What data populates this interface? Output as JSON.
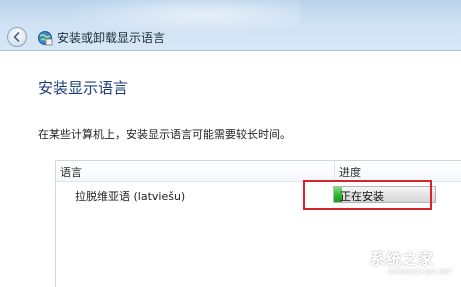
{
  "window": {
    "title": "安装或卸载显示语言"
  },
  "icons": {
    "back": "back-arrow-icon",
    "window": "globe-language-icon"
  },
  "dialog": {
    "heading": "安装显示语言",
    "info": "在某些计算机上，安装显示语言可能需要较长时间。"
  },
  "list": {
    "columns": {
      "language": "语言",
      "progress": "进度"
    },
    "rows": [
      {
        "language": "拉脱维亚语 (latviešu)",
        "status": "正在安装",
        "progress_fraction": 0.08
      }
    ]
  },
  "watermark": {
    "text": "系统之家",
    "url": "XITONGZHIJIA.NET"
  },
  "colors": {
    "heading": "#1f3d7a",
    "progress_green": "#2fb42f",
    "highlight_red": "#d3252b"
  }
}
